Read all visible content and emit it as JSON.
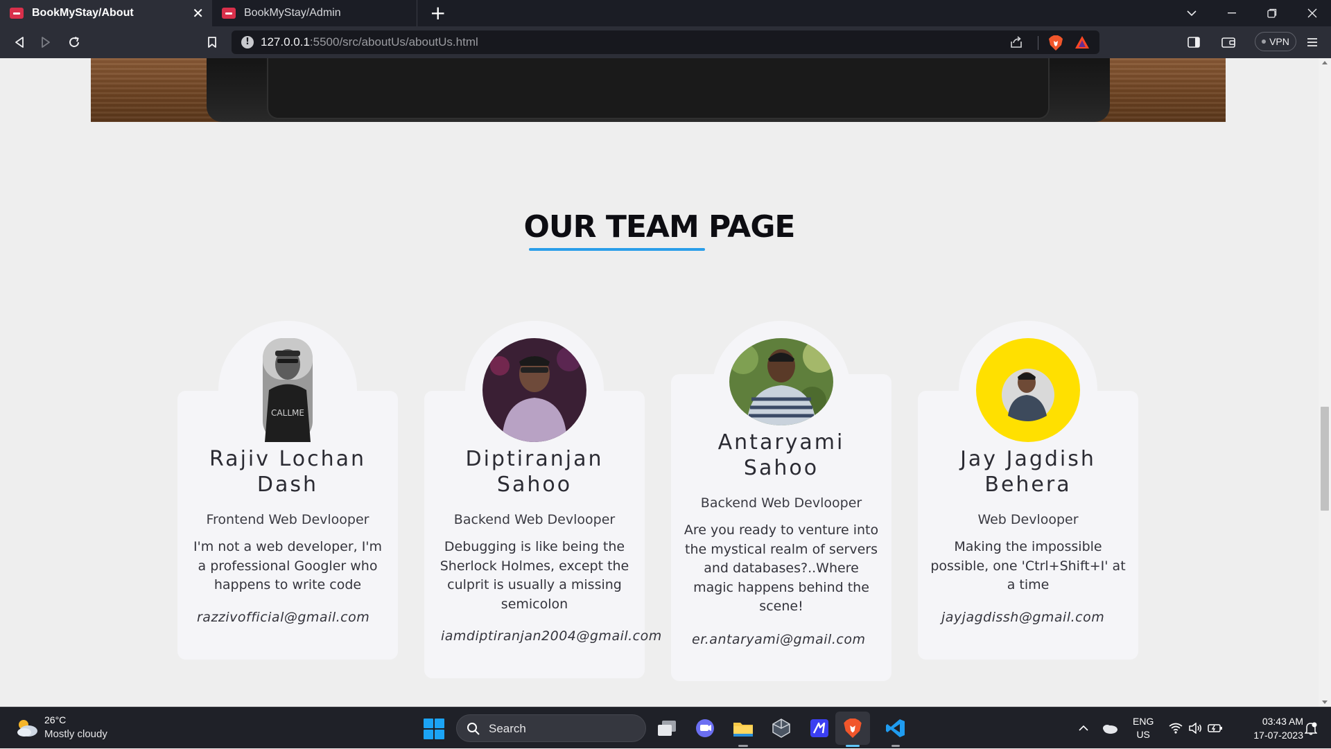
{
  "browser": {
    "tabs": [
      {
        "title": "BookMyStay/About",
        "active": true
      },
      {
        "title": "BookMyStay/Admin",
        "active": false
      }
    ],
    "new_tab_label": "+",
    "address": {
      "host": "127.0.0.1",
      "path": ":5500/src/aboutUs/aboutUs.html"
    },
    "vpn_label": "VPN"
  },
  "page": {
    "heading": "OUR TEAM PAGE",
    "accent_color": "#2a9ee9",
    "team": [
      {
        "name_line1": "Rajiv Lochan",
        "name_line2": "Dash",
        "role": "Frontend Web Devlooper",
        "quote": "I'm not a web developer, I'm a professional Googler who happens to write code",
        "email": "razzivofficial@gmail.com",
        "avatar_bg": "#bdbdbd"
      },
      {
        "name_line1": "Diptiranjan",
        "name_line2": "Sahoo",
        "role": "Backend Web Devlooper",
        "quote": "Debugging is like being the Sherlock Holmes, except the culprit is usually a missing semicolon",
        "email": "iamdiptiranjan2004@gmail.com",
        "avatar_bg": "#3a1f34"
      },
      {
        "name_line1": "Antaryami",
        "name_line2": "Sahoo",
        "role": "Backend Web Devlooper",
        "quote": "Are you ready to venture into the mystical realm of servers and databases?..Where magic happens behind the scene!",
        "email": "er.antaryami@gmail.com",
        "avatar_bg": "#5f7f3c"
      },
      {
        "name_line1": "Jay Jagdish",
        "name_line2": "Behera",
        "role": "Web Devlooper",
        "quote": "Making the impossible possible, one 'Ctrl+Shift+I' at a time",
        "email": "jayjagdissh@gmail.com",
        "avatar_bg": "#ffe000"
      }
    ]
  },
  "taskbar": {
    "weather_temp": "26°C",
    "weather_desc": "Mostly cloudy",
    "search_label": "Search",
    "lang_line1": "ENG",
    "lang_line2": "US",
    "time": "03:43 AM",
    "date": "17-07-2023"
  }
}
